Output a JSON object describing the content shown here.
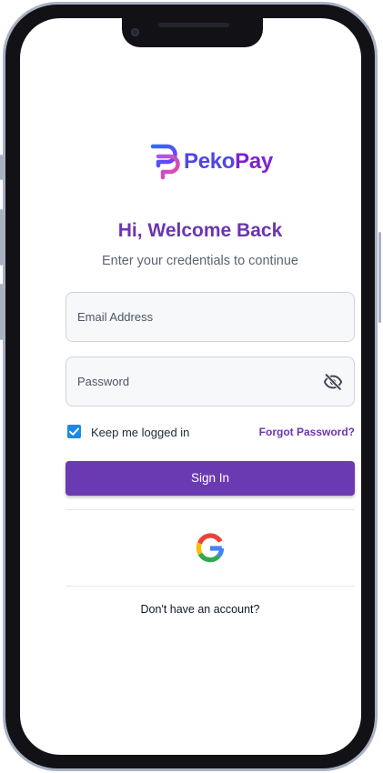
{
  "brand": {
    "name_part1": "Peko",
    "name_part2": "Pay",
    "logo_icon": "pekopay-logo-icon"
  },
  "login": {
    "title": "Hi, Welcome Back",
    "subtitle": "Enter your credentials to continue"
  },
  "form": {
    "email": {
      "placeholder": "Email Address",
      "value": ""
    },
    "password": {
      "placeholder": "Password",
      "value": "",
      "visibility_icon": "eye-off-icon"
    },
    "remember": {
      "label": "Keep me logged in",
      "checked": true
    },
    "forgot_label": "Forgot Password?",
    "submit_label": "Sign In"
  },
  "social": {
    "google_icon": "google-icon"
  },
  "footer": {
    "signup_text": "Don't have an account?"
  },
  "colors": {
    "primary": "#6a3ab2",
    "title": "#6b35b0",
    "checkbox": "#1e88e5"
  }
}
